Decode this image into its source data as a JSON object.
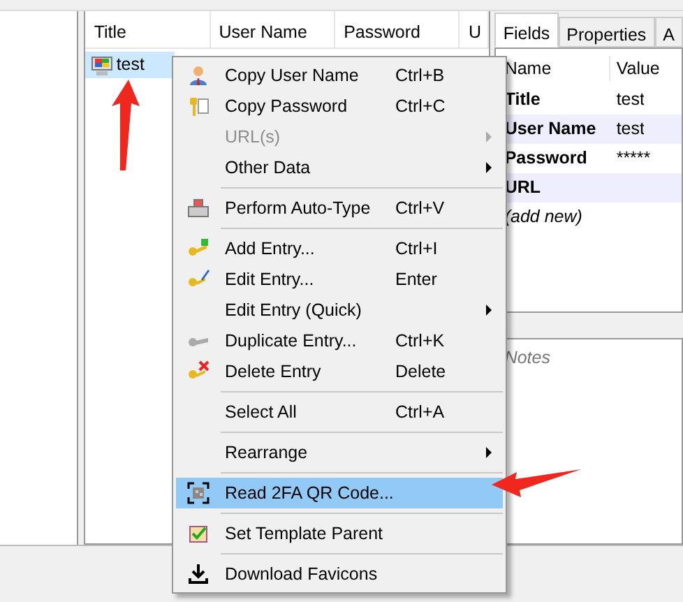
{
  "entry_list": {
    "columns": [
      "Title",
      "User Name",
      "Password",
      "U"
    ],
    "rows": [
      {
        "title": "test",
        "selected": true
      }
    ]
  },
  "details": {
    "tabs": [
      {
        "label": "Fields",
        "selected": true
      },
      {
        "label": "Properties",
        "selected": false
      },
      {
        "label": "A",
        "selected": false
      }
    ],
    "columns": [
      "Name",
      "Value"
    ],
    "fields": [
      {
        "name": "Title",
        "value": "test"
      },
      {
        "name": "User Name",
        "value": "test"
      },
      {
        "name": "Password",
        "value": "*****"
      },
      {
        "name": "URL"
      }
    ],
    "add_new": "(add new)",
    "notes_placeholder": "Notes"
  },
  "context_menu": {
    "items": [
      {
        "kind": "item",
        "label": "Copy User Name",
        "shortcut": "Ctrl+B",
        "submenu": false,
        "disabled": false,
        "selected": false
      },
      {
        "kind": "item",
        "label": "Copy Password",
        "shortcut": "Ctrl+C",
        "submenu": false,
        "disabled": false,
        "selected": false
      },
      {
        "kind": "item",
        "label": "URL(s)",
        "submenu": true,
        "disabled": true,
        "selected": false
      },
      {
        "kind": "item",
        "label": "Other Data",
        "submenu": true,
        "disabled": false,
        "selected": false
      },
      {
        "kind": "separator"
      },
      {
        "kind": "item",
        "label": "Perform Auto-Type",
        "shortcut": "Ctrl+V",
        "submenu": false,
        "disabled": false,
        "selected": false
      },
      {
        "kind": "separator"
      },
      {
        "kind": "item",
        "label": "Add Entry...",
        "shortcut": "Ctrl+I",
        "submenu": false,
        "disabled": false,
        "selected": false
      },
      {
        "kind": "item",
        "label": "Edit Entry...",
        "shortcut": "Enter",
        "submenu": false,
        "disabled": false,
        "selected": false
      },
      {
        "kind": "item",
        "label": "Edit Entry (Quick)",
        "submenu": true,
        "disabled": false,
        "selected": false
      },
      {
        "kind": "item",
        "label": "Duplicate Entry...",
        "shortcut": "Ctrl+K",
        "submenu": false,
        "disabled": false,
        "selected": false
      },
      {
        "kind": "item",
        "label": "Delete Entry",
        "shortcut": "Delete",
        "submenu": false,
        "disabled": false,
        "selected": false
      },
      {
        "kind": "separator"
      },
      {
        "kind": "item",
        "label": "Select All",
        "shortcut": "Ctrl+A",
        "submenu": false,
        "disabled": false,
        "selected": false
      },
      {
        "kind": "separator"
      },
      {
        "kind": "item",
        "label": "Rearrange",
        "submenu": true,
        "disabled": false,
        "selected": false
      },
      {
        "kind": "separator"
      },
      {
        "kind": "item",
        "label": "Read 2FA QR Code...",
        "submenu": false,
        "disabled": false,
        "selected": true
      },
      {
        "kind": "separator"
      },
      {
        "kind": "item",
        "label": "Set Template Parent",
        "submenu": false,
        "disabled": false,
        "selected": false
      },
      {
        "kind": "separator"
      },
      {
        "kind": "item",
        "label": "Download Favicons",
        "submenu": false,
        "disabled": false,
        "selected": false
      }
    ]
  }
}
